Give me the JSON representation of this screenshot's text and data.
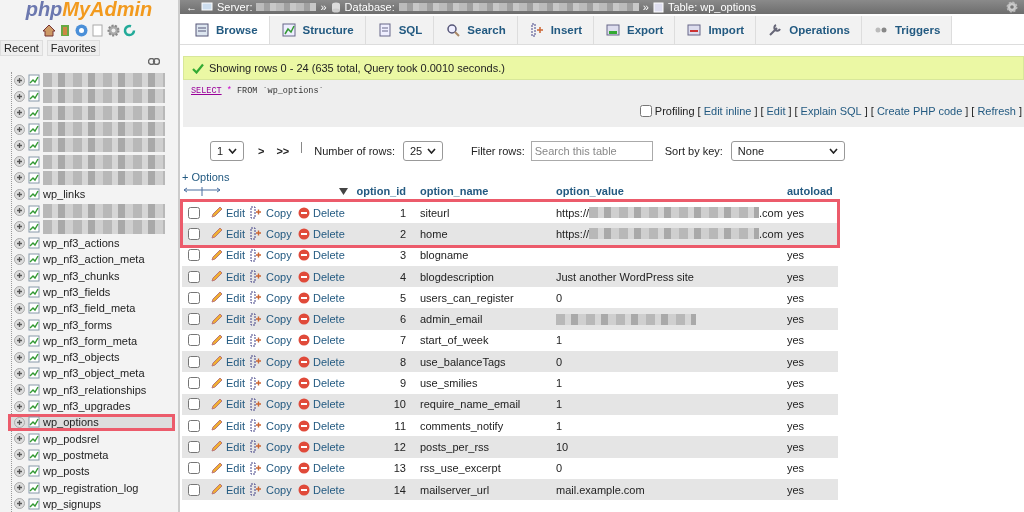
{
  "sidebar": {
    "logo": {
      "part_1": "php",
      "part_2": "MyAdmin"
    },
    "nav_tabs": [
      "Recent",
      "Favorites"
    ],
    "tables": [
      {
        "redacted": true,
        "selected": false
      },
      {
        "redacted": true,
        "selected": false
      },
      {
        "redacted": true,
        "selected": false
      },
      {
        "redacted": true,
        "selected": false
      },
      {
        "redacted": true,
        "selected": false
      },
      {
        "redacted": true,
        "selected": false
      },
      {
        "redacted": true,
        "selected": false
      },
      {
        "name": "wp_links",
        "redacted": false,
        "selected": false
      },
      {
        "redacted": true,
        "selected": false
      },
      {
        "redacted": true,
        "selected": false
      },
      {
        "name": "wp_nf3_actions",
        "redacted": false,
        "selected": false
      },
      {
        "name": "wp_nf3_action_meta",
        "redacted": false,
        "selected": false
      },
      {
        "name": "wp_nf3_chunks",
        "redacted": false,
        "selected": false
      },
      {
        "name": "wp_nf3_fields",
        "redacted": false,
        "selected": false
      },
      {
        "name": "wp_nf3_field_meta",
        "redacted": false,
        "selected": false
      },
      {
        "name": "wp_nf3_forms",
        "redacted": false,
        "selected": false
      },
      {
        "name": "wp_nf3_form_meta",
        "redacted": false,
        "selected": false
      },
      {
        "name": "wp_nf3_objects",
        "redacted": false,
        "selected": false
      },
      {
        "name": "wp_nf3_object_meta",
        "redacted": false,
        "selected": false
      },
      {
        "name": "wp_nf3_relationships",
        "redacted": false,
        "selected": false
      },
      {
        "name": "wp_nf3_upgrades",
        "redacted": false,
        "selected": false
      },
      {
        "name": "wp_options",
        "redacted": false,
        "selected": true
      },
      {
        "name": "wp_podsrel",
        "redacted": false,
        "selected": false
      },
      {
        "name": "wp_postmeta",
        "redacted": false,
        "selected": false
      },
      {
        "name": "wp_posts",
        "redacted": false,
        "selected": false
      },
      {
        "name": "wp_registration_log",
        "redacted": false,
        "selected": false
      },
      {
        "name": "wp_signups",
        "redacted": false,
        "selected": false
      }
    ]
  },
  "breadcrumb": {
    "back": "←",
    "server_label": "Server:",
    "separator_1": "»",
    "database_label": "Database:",
    "separator_2": "»",
    "table_label": "Table: wp_options"
  },
  "tabs": [
    {
      "label": "Browse",
      "kind": "browse",
      "selected": true
    },
    {
      "label": "Structure",
      "kind": "structure",
      "selected": false
    },
    {
      "label": "SQL",
      "kind": "sql",
      "selected": false
    },
    {
      "label": "Search",
      "kind": "search",
      "selected": false
    },
    {
      "label": "Insert",
      "kind": "insert",
      "selected": false
    },
    {
      "label": "Export",
      "kind": "export",
      "selected": false
    },
    {
      "label": "Import",
      "kind": "import",
      "selected": false
    },
    {
      "label": "Operations",
      "kind": "operations",
      "selected": false
    },
    {
      "label": "Triggers",
      "kind": "triggers",
      "selected": false
    }
  ],
  "notice": "Showing rows 0 - 24 (635 total, Query took 0.0010 seconds.)",
  "sql": {
    "keyword": "SELECT",
    "star": "*",
    "from": "FROM",
    "table": "`wp_options`"
  },
  "profiling": {
    "label": "Profiling",
    "checked": false,
    "links": [
      {
        "before": "[",
        "label": "Edit inline",
        "after": "]"
      },
      {
        "before": "[",
        "label": "Edit",
        "after": "]"
      },
      {
        "before": "[",
        "label": "Explain SQL",
        "after": "]"
      },
      {
        "before": "[",
        "label": "Create PHP code",
        "after": "]"
      },
      {
        "before": "[",
        "label": "Refresh",
        "after": "]"
      }
    ]
  },
  "pager": {
    "page": "1",
    "next": ">",
    "last": ">>",
    "rows_label": "Number of rows:",
    "rows": "25",
    "filter_label": "Filter rows:",
    "filter_placeholder": "Search this table",
    "sort_label": "Sort by key:",
    "sort": "None"
  },
  "options_link": "+ Options",
  "columns": [
    "option_id",
    "option_name",
    "option_value",
    "autoload"
  ],
  "rows": [
    {
      "actions": [
        "Edit",
        "Copy",
        "Delete"
      ],
      "id": "1",
      "name": "siteurl",
      "value": "https://",
      "value_suffix": ".com",
      "redacted": true,
      "autoload": "yes",
      "checked": false,
      "highlighted": true
    },
    {
      "actions": [
        "Edit",
        "Copy",
        "Delete"
      ],
      "id": "2",
      "name": "home",
      "value": "https://",
      "value_suffix": ".com",
      "redacted": true,
      "autoload": "yes",
      "checked": false,
      "highlighted": true
    },
    {
      "actions": [
        "Edit",
        "Copy",
        "Delete"
      ],
      "id": "3",
      "name": "blogname",
      "redacted": false,
      "autoload": "yes",
      "checked": false,
      "highlighted": false
    },
    {
      "actions": [
        "Edit",
        "Copy",
        "Delete"
      ],
      "id": "4",
      "name": "blogdescription",
      "value": "Just another WordPress site",
      "redacted": false,
      "autoload": "yes",
      "checked": false,
      "highlighted": false
    },
    {
      "actions": [
        "Edit",
        "Copy",
        "Delete"
      ],
      "id": "5",
      "name": "users_can_register",
      "value": "0",
      "redacted": false,
      "autoload": "yes",
      "checked": false,
      "highlighted": false
    },
    {
      "actions": [
        "Edit",
        "Copy",
        "Delete"
      ],
      "id": "6",
      "name": "admin_email",
      "redacted": true,
      "autoload": "yes",
      "checked": false,
      "highlighted": false
    },
    {
      "actions": [
        "Edit",
        "Copy",
        "Delete"
      ],
      "id": "7",
      "name": "start_of_week",
      "value": "1",
      "redacted": false,
      "autoload": "yes",
      "checked": false,
      "highlighted": false
    },
    {
      "actions": [
        "Edit",
        "Copy",
        "Delete"
      ],
      "id": "8",
      "name": "use_balanceTags",
      "value": "0",
      "redacted": false,
      "autoload": "yes",
      "checked": false,
      "highlighted": false
    },
    {
      "actions": [
        "Edit",
        "Copy",
        "Delete"
      ],
      "id": "9",
      "name": "use_smilies",
      "value": "1",
      "redacted": false,
      "autoload": "yes",
      "checked": false,
      "highlighted": false
    },
    {
      "actions": [
        "Edit",
        "Copy",
        "Delete"
      ],
      "id": "10",
      "name": "require_name_email",
      "value": "1",
      "redacted": false,
      "autoload": "yes",
      "checked": false,
      "highlighted": false
    },
    {
      "actions": [
        "Edit",
        "Copy",
        "Delete"
      ],
      "id": "11",
      "name": "comments_notify",
      "value": "1",
      "redacted": false,
      "autoload": "yes",
      "checked": false,
      "highlighted": false
    },
    {
      "actions": [
        "Edit",
        "Copy",
        "Delete"
      ],
      "id": "12",
      "name": "posts_per_rss",
      "value": "10",
      "redacted": false,
      "autoload": "yes",
      "checked": false,
      "highlighted": false
    },
    {
      "actions": [
        "Edit",
        "Copy",
        "Delete"
      ],
      "id": "13",
      "name": "rss_use_excerpt",
      "value": "0",
      "redacted": false,
      "autoload": "yes",
      "checked": false,
      "highlighted": false
    },
    {
      "actions": [
        "Edit",
        "Copy",
        "Delete"
      ],
      "id": "14",
      "name": "mailserver_url",
      "value": "mail.example.com",
      "redacted": false,
      "autoload": "yes",
      "checked": false,
      "highlighted": false
    }
  ]
}
